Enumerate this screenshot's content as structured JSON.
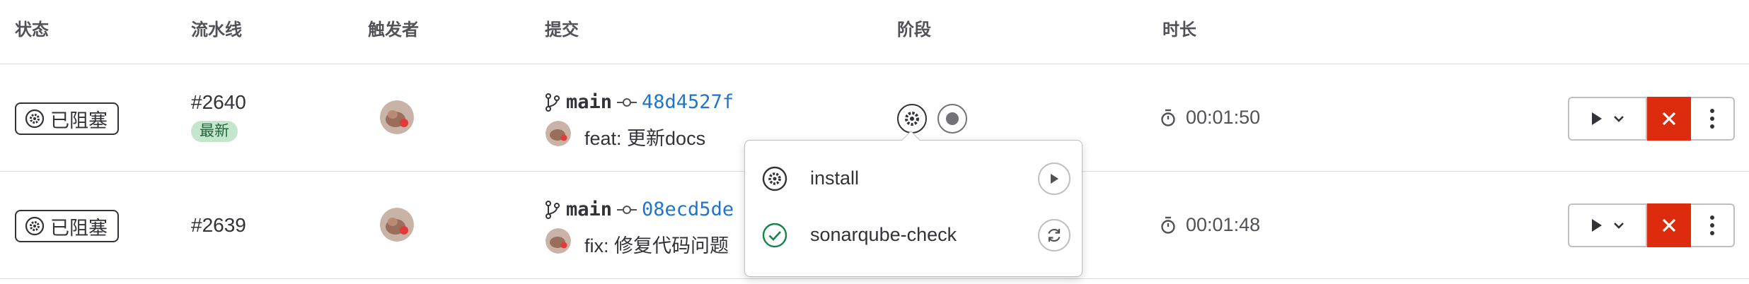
{
  "headers": {
    "status": "状态",
    "pipeline": "流水线",
    "triggerer": "触发者",
    "commit": "提交",
    "stages": "阶段",
    "duration": "时长"
  },
  "rows": [
    {
      "status": "已阻塞",
      "pipeline_id": "#2640",
      "latest_badge": "最新",
      "branch": "main",
      "sha": "48d4527f",
      "commit_message": "feat: 更新docs",
      "duration": "00:01:50"
    },
    {
      "status": "已阻塞",
      "pipeline_id": "#2639",
      "branch": "main",
      "sha": "08ecd5de",
      "commit_message": "fix: 修复代码问题",
      "duration": "00:01:48"
    }
  ],
  "stage_dropdown": {
    "jobs": [
      {
        "name": "install",
        "status": "manual",
        "action": "play"
      },
      {
        "name": "sonarqube-check",
        "status": "success",
        "action": "retry"
      }
    ]
  },
  "colors": {
    "sha_link": "#1f75cb",
    "cancel_button": "#dd2b0e",
    "latest_badge_bg": "#c3e6cd",
    "success": "#108548"
  }
}
